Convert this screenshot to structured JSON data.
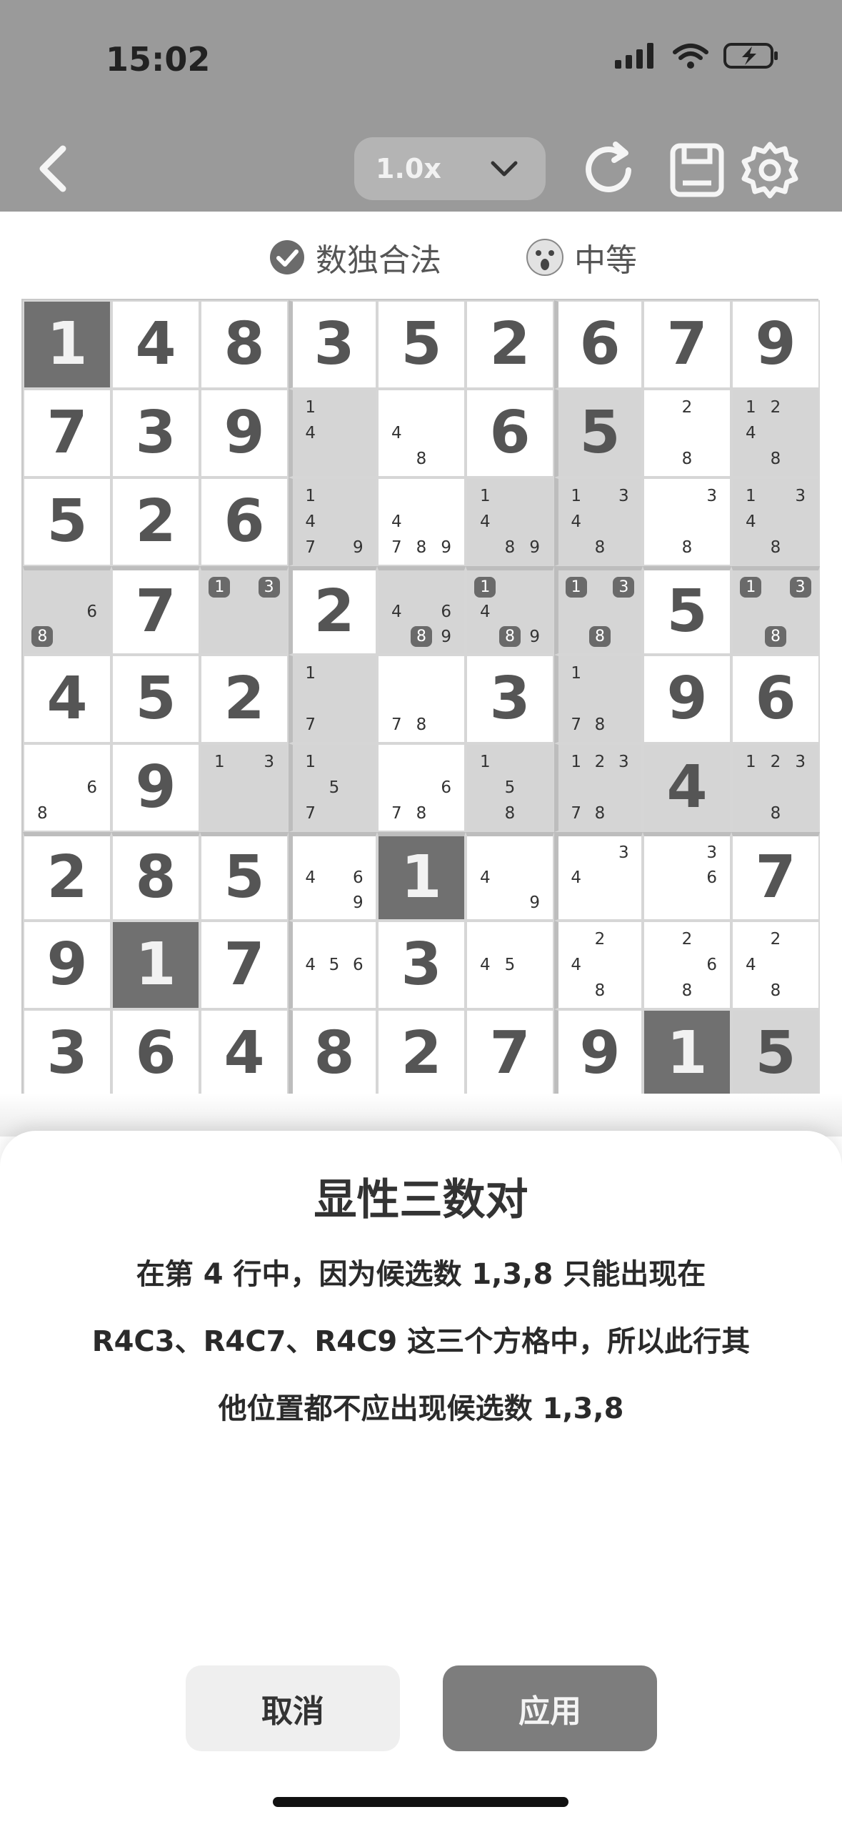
{
  "status_bar": {
    "time": "15:02"
  },
  "toolbar": {
    "speed": "1.0x"
  },
  "info": {
    "legal_label": "数独合法",
    "difficulty": "中等"
  },
  "colors": {
    "shade": "#d5d5d5",
    "highlight": "#707070",
    "bar": "#9a9a9a"
  },
  "grid": [
    [
      {
        "v": "1",
        "s": "dark"
      },
      {
        "v": "4"
      },
      {
        "v": "8"
      },
      {
        "v": "3"
      },
      {
        "v": "5"
      },
      {
        "v": "2"
      },
      {
        "v": "6"
      },
      {
        "v": "7"
      },
      {
        "v": "9"
      }
    ],
    [
      {
        "v": "7"
      },
      {
        "v": "3"
      },
      {
        "v": "9"
      },
      {
        "c": [
          "1",
          "",
          "",
          "4",
          "",
          "",
          "",
          "",
          ""
        ],
        "s": "shade"
      },
      {
        "c": [
          "",
          "",
          "",
          "4",
          "",
          "",
          "",
          "8",
          ""
        ]
      },
      {
        "v": "6"
      },
      {
        "v": "5",
        "s": "shade"
      },
      {
        "c": [
          "",
          "2",
          "",
          "",
          "",
          "",
          "",
          "8",
          ""
        ]
      },
      {
        "c": [
          "1",
          "2",
          "",
          "4",
          "",
          "",
          "",
          "8",
          ""
        ],
        "s": "shade"
      }
    ],
    [
      {
        "v": "5"
      },
      {
        "v": "2"
      },
      {
        "v": "6"
      },
      {
        "c": [
          "1",
          "",
          "",
          "4",
          "",
          "",
          "7",
          "",
          "9"
        ],
        "s": "shade"
      },
      {
        "c": [
          "",
          "",
          "",
          "4",
          "",
          "",
          "7",
          "8",
          "9"
        ]
      },
      {
        "c": [
          "1",
          "",
          "",
          "4",
          "",
          "",
          "",
          "8",
          "9"
        ],
        "s": "shade"
      },
      {
        "c": [
          "1",
          "",
          "3",
          "4",
          "",
          "",
          "",
          "8",
          ""
        ],
        "s": "shade"
      },
      {
        "c": [
          "",
          "",
          "3",
          "",
          "",
          "",
          "",
          "8",
          ""
        ]
      },
      {
        "c": [
          "1",
          "",
          "3",
          "4",
          "",
          "",
          "",
          "8",
          ""
        ],
        "s": "shade"
      }
    ],
    [
      {
        "c": [
          "",
          "",
          "",
          "",
          "",
          "6",
          "8",
          "",
          ""
        ],
        "h": [
          "8"
        ],
        "s": "shade"
      },
      {
        "v": "7"
      },
      {
        "c": [
          "1",
          "",
          "3",
          "",
          "",
          "",
          "",
          "",
          ""
        ],
        "h": [
          "1",
          "3"
        ],
        "s": "shade"
      },
      {
        "v": "2"
      },
      {
        "c": [
          "",
          "",
          "",
          "4",
          "",
          "6",
          "",
          "8",
          "9"
        ],
        "h": [
          "8"
        ],
        "s": "shade"
      },
      {
        "c": [
          "1",
          "",
          "",
          "4",
          "",
          "",
          "",
          "8",
          "9"
        ],
        "h": [
          "1",
          "8"
        ],
        "s": "shade"
      },
      {
        "c": [
          "1",
          "",
          "3",
          "",
          "",
          "",
          "",
          "8",
          ""
        ],
        "h": [
          "1",
          "3",
          "8"
        ],
        "s": "shade"
      },
      {
        "v": "5"
      },
      {
        "c": [
          "1",
          "",
          "3",
          "",
          "",
          "",
          "",
          "8",
          ""
        ],
        "h": [
          "1",
          "3",
          "8"
        ],
        "s": "shade"
      }
    ],
    [
      {
        "v": "4"
      },
      {
        "v": "5"
      },
      {
        "v": "2"
      },
      {
        "c": [
          "1",
          "",
          "",
          "",
          "",
          "",
          "7",
          "",
          ""
        ],
        "s": "shade"
      },
      {
        "c": [
          "",
          "",
          "",
          "",
          "",
          "",
          "7",
          "8",
          ""
        ]
      },
      {
        "v": "3"
      },
      {
        "c": [
          "1",
          "",
          "",
          "",
          "",
          "",
          "7",
          "8",
          ""
        ],
        "s": "shade"
      },
      {
        "v": "9"
      },
      {
        "v": "6"
      }
    ],
    [
      {
        "c": [
          "",
          "",
          "",
          "",
          "",
          "6",
          "8",
          "",
          ""
        ]
      },
      {
        "v": "9"
      },
      {
        "c": [
          "1",
          "",
          "3",
          "",
          "",
          "",
          "",
          "",
          ""
        ],
        "s": "shade"
      },
      {
        "c": [
          "1",
          "",
          "",
          "",
          "5",
          "",
          "7",
          "",
          ""
        ],
        "s": "shade"
      },
      {
        "c": [
          "",
          "",
          "",
          "",
          "",
          "6",
          "7",
          "8",
          ""
        ]
      },
      {
        "c": [
          "1",
          "",
          "",
          "",
          "5",
          "",
          "",
          "8",
          ""
        ],
        "s": "shade"
      },
      {
        "c": [
          "1",
          "2",
          "3",
          "",
          "",
          "",
          "7",
          "8",
          ""
        ],
        "s": "shade"
      },
      {
        "v": "4",
        "s": "shade"
      },
      {
        "c": [
          "1",
          "2",
          "3",
          "",
          "",
          "",
          "",
          "8",
          ""
        ],
        "s": "shade"
      }
    ],
    [
      {
        "v": "2"
      },
      {
        "v": "8"
      },
      {
        "v": "5"
      },
      {
        "c": [
          "",
          "",
          "",
          "4",
          "",
          "6",
          "",
          "",
          "9"
        ]
      },
      {
        "v": "1",
        "s": "dark"
      },
      {
        "c": [
          "",
          "",
          "",
          "4",
          "",
          "",
          "",
          "",
          "9"
        ]
      },
      {
        "c": [
          "",
          "",
          "3",
          "4",
          "",
          "",
          "",
          "",
          ""
        ]
      },
      {
        "c": [
          "",
          "",
          "3",
          "",
          "",
          "6",
          "",
          "",
          ""
        ]
      },
      {
        "v": "7"
      }
    ],
    [
      {
        "v": "9"
      },
      {
        "v": "1",
        "s": "dark"
      },
      {
        "v": "7"
      },
      {
        "c": [
          "",
          "",
          "",
          "4",
          "5",
          "6",
          "",
          "",
          ""
        ]
      },
      {
        "v": "3"
      },
      {
        "c": [
          "",
          "",
          "",
          "4",
          "5",
          "",
          "",
          "",
          ""
        ]
      },
      {
        "c": [
          "",
          "2",
          "",
          "4",
          "",
          "",
          "",
          "8",
          ""
        ]
      },
      {
        "c": [
          "",
          "2",
          "",
          "",
          "",
          "6",
          "",
          "8",
          ""
        ]
      },
      {
        "c": [
          "",
          "2",
          "",
          "4",
          "",
          "",
          "",
          "8",
          ""
        ]
      }
    ],
    [
      {
        "v": "3"
      },
      {
        "v": "6"
      },
      {
        "v": "4"
      },
      {
        "v": "8"
      },
      {
        "v": "2"
      },
      {
        "v": "7"
      },
      {
        "v": "9"
      },
      {
        "v": "1",
        "s": "dark"
      },
      {
        "v": "5",
        "s": "shade"
      }
    ]
  ],
  "sheet": {
    "title": "显性三数对",
    "lines": [
      "在第 4 行中，因为候选数 1,3,8 只能出现在",
      "R4C3、R4C7、R4C9 这三个方格中，所以此行其",
      "他位置都不应出现候选数 1,3,8"
    ],
    "cancel": "取消",
    "apply": "应用"
  }
}
